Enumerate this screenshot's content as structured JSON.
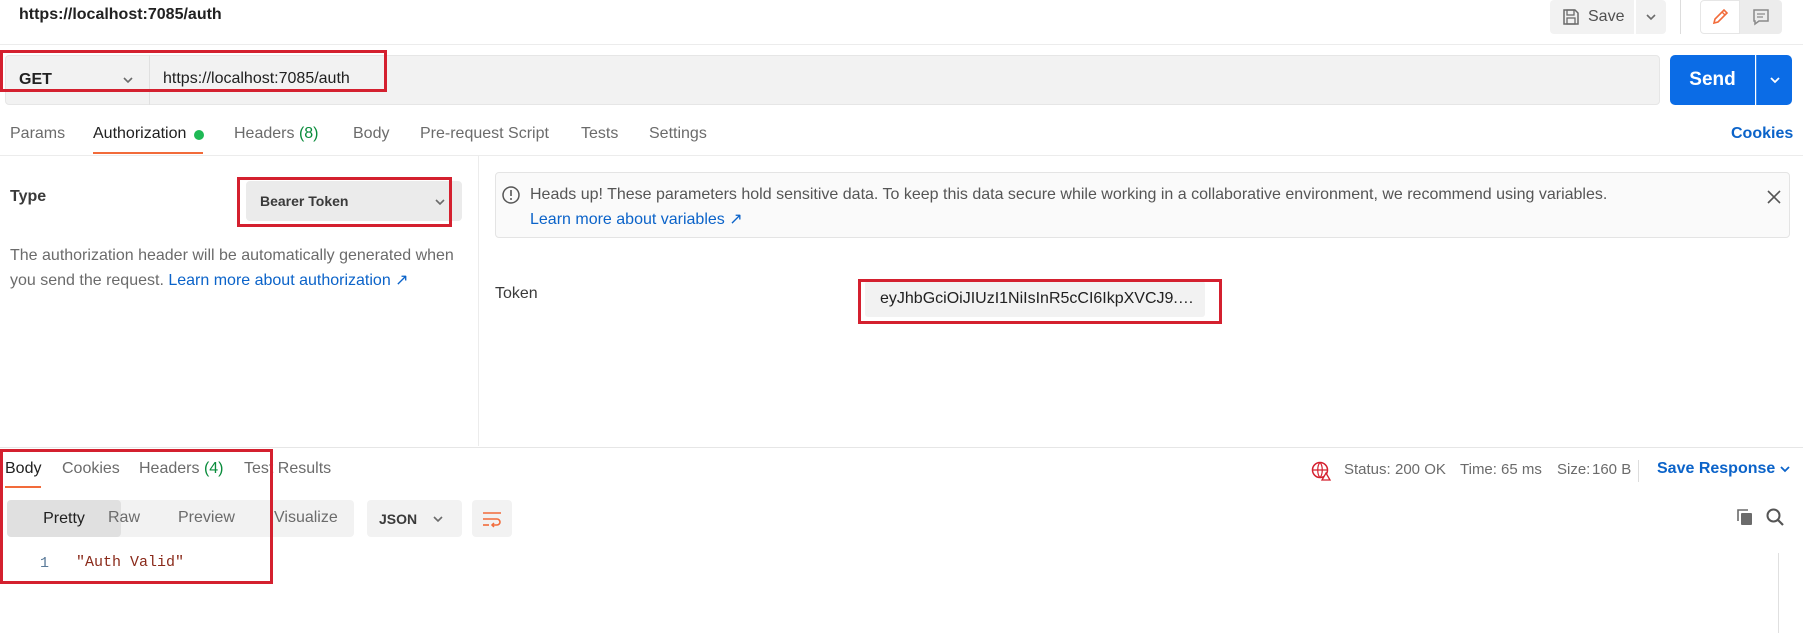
{
  "header": {
    "title": "https://localhost:7085/auth",
    "save_label": "Save"
  },
  "request": {
    "method": "GET",
    "url": "https://localhost:7085/auth",
    "send_label": "Send"
  },
  "tabs": {
    "params": "Params",
    "authorization": "Authorization",
    "headers": "Headers",
    "headers_count": "(8)",
    "body": "Body",
    "prerequest": "Pre-request Script",
    "tests": "Tests",
    "settings": "Settings",
    "cookies": "Cookies"
  },
  "auth": {
    "type_label": "Type",
    "type_value": "Bearer Token",
    "description": "The authorization header will be automatically generated when you send the request.",
    "learn_more": "Learn more about authorization ↗",
    "alert_text": "Heads up! These parameters hold sensitive data. To keep this data secure while working in a collaborative environment, we recommend using variables.",
    "alert_link": "Learn more about variables ↗",
    "token_label": "Token",
    "token_value": "eyJhbGciOiJIUzI1NiIsInR5cCI6IkpXVCJ9.eyJ..."
  },
  "response": {
    "tabs": {
      "body": "Body",
      "cookies": "Cookies",
      "headers": "Headers",
      "headers_count": "(4)",
      "test_results": "Test Results"
    },
    "status_label": "Status:",
    "status_value": "200 OK",
    "time_label": "Time:",
    "time_value": "65 ms",
    "size_label": "Size:",
    "size_value": "160 B",
    "save_response": "Save Response",
    "views": {
      "pretty": "Pretty",
      "raw": "Raw",
      "preview": "Preview",
      "visualize": "Visualize"
    },
    "format": "JSON",
    "line_number": "1",
    "body_text": "\"Auth Valid\""
  },
  "colors": {
    "accent": "#f26b3a",
    "send": "#0b6ce6",
    "link": "#0b63c9",
    "success": "#0a8c3c",
    "annotation": "#d4202f"
  }
}
